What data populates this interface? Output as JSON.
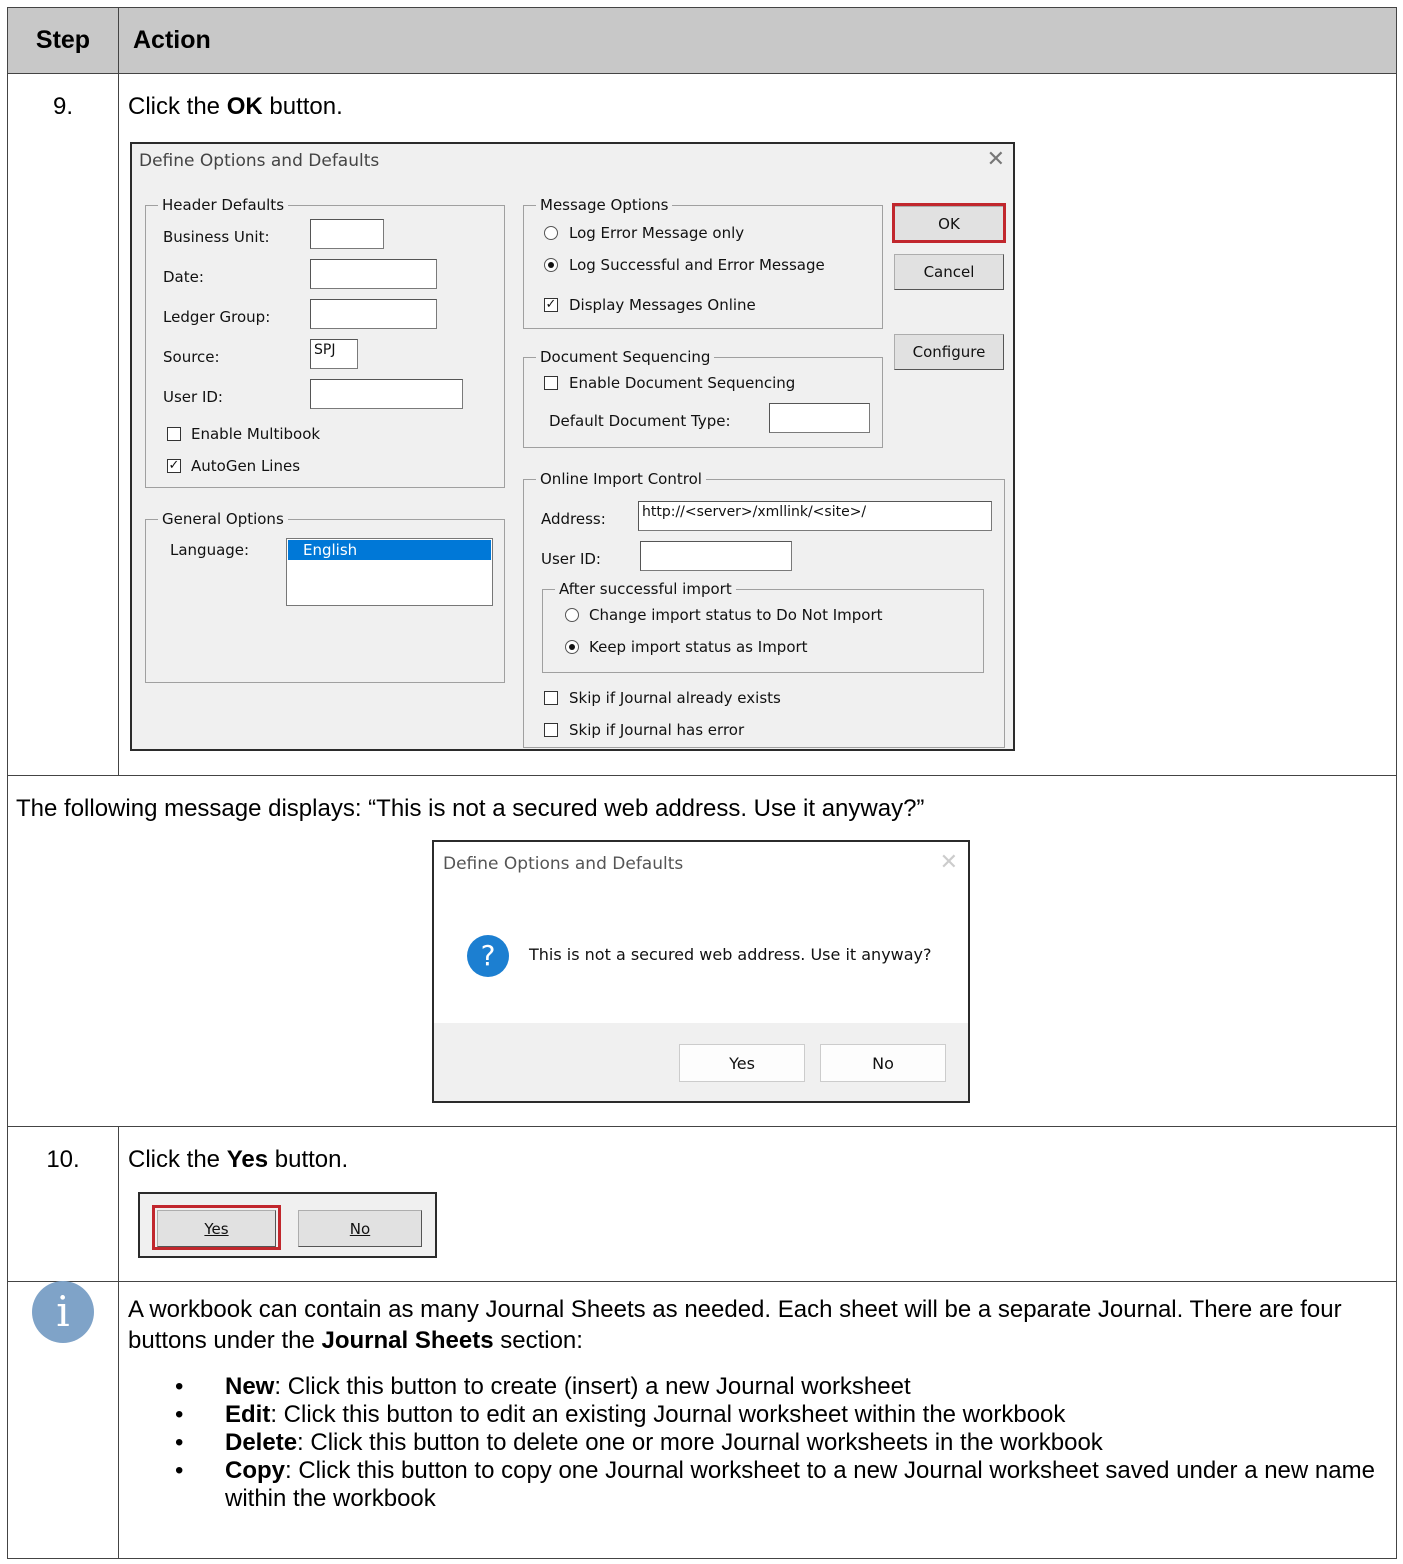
{
  "table": {
    "header_step": "Step",
    "header_action": "Action"
  },
  "step9": {
    "number": "9.",
    "prefix": "Click the ",
    "bold": "OK",
    "suffix": " button."
  },
  "options_dialog": {
    "title": "Define Options and Defaults",
    "close": "✕",
    "header_defaults": {
      "title": "Header Defaults",
      "business_unit_label": "Business Unit:",
      "business_unit_value": "",
      "date_label": "Date:",
      "date_value": "",
      "ledger_group_label": "Ledger Group:",
      "ledger_group_value": "",
      "source_label": "Source:",
      "source_value": "SPJ",
      "user_id_label": "User ID:",
      "user_id_value": "",
      "enable_multibook_label": "Enable Multibook",
      "enable_multibook_checked": false,
      "autogen_lines_label": "AutoGen Lines",
      "autogen_lines_checked": true
    },
    "general_options": {
      "title": "General Options",
      "language_label": "Language:",
      "language_selected": "English"
    },
    "message_options": {
      "title": "Message Options",
      "log_error_only": "Log Error Message only",
      "log_success_error": "Log Successful and Error Message",
      "selected": "log_success_error",
      "display_online": "Display Messages Online",
      "display_online_checked": true
    },
    "document_sequencing": {
      "title": "Document Sequencing",
      "enable_label": "Enable Document Sequencing",
      "enable_checked": false,
      "default_type_label": "Default Document Type:",
      "default_type_value": ""
    },
    "online_import": {
      "title": "Online Import Control",
      "address_label": "Address:",
      "address_value": "http://<server>/xmllink/<site>/",
      "user_id_label": "User ID:",
      "user_id_value": "",
      "after_import": {
        "title": "After successful import",
        "option_do_not_import": "Change import status to Do Not Import",
        "option_keep_import": "Keep import status as Import",
        "selected": "option_keep_import"
      },
      "skip_exists_label": "Skip if Journal already exists",
      "skip_exists_checked": false,
      "skip_error_label": "Skip if Journal has error",
      "skip_error_checked": false
    },
    "buttons": {
      "ok": "OK",
      "cancel": "Cancel",
      "configure": "Configure"
    },
    "highlight_color": "#c1272d"
  },
  "message_row": {
    "text": "The following message displays: “This is not a secured web address. Use it anyway?”"
  },
  "confirm_dialog": {
    "title": "Define Options and Defaults",
    "close": "✕",
    "icon": "?",
    "message": "This is not a secured web address.  Use it anyway?",
    "yes": "Yes",
    "no": "No",
    "icon_color": "#1c7fd1"
  },
  "step10": {
    "number": "10.",
    "prefix": "Click the ",
    "bold": "Yes",
    "suffix": " button.",
    "yes": "Yes",
    "no": "No"
  },
  "info": {
    "icon": "i",
    "icon_color": "#7fa3c8",
    "intro_1": "A workbook can contain as many Journal Sheets as needed. Each sheet will be a separate Journal. There are four buttons under the ",
    "intro_bold": "Journal Sheets",
    "intro_2": " section:",
    "items": [
      {
        "term": "New",
        "desc": ": Click this button to create (insert) a new Journal worksheet"
      },
      {
        "term": "Edit",
        "desc": ": Click this button to edit an existing Journal worksheet within the workbook"
      },
      {
        "term": "Delete",
        "desc": ": Click this button to delete one or more Journal worksheets in the workbook"
      },
      {
        "term": "Copy",
        "desc": ": Click this button to copy one Journal worksheet to a new Journal worksheet saved under a new name within the workbook"
      }
    ]
  }
}
